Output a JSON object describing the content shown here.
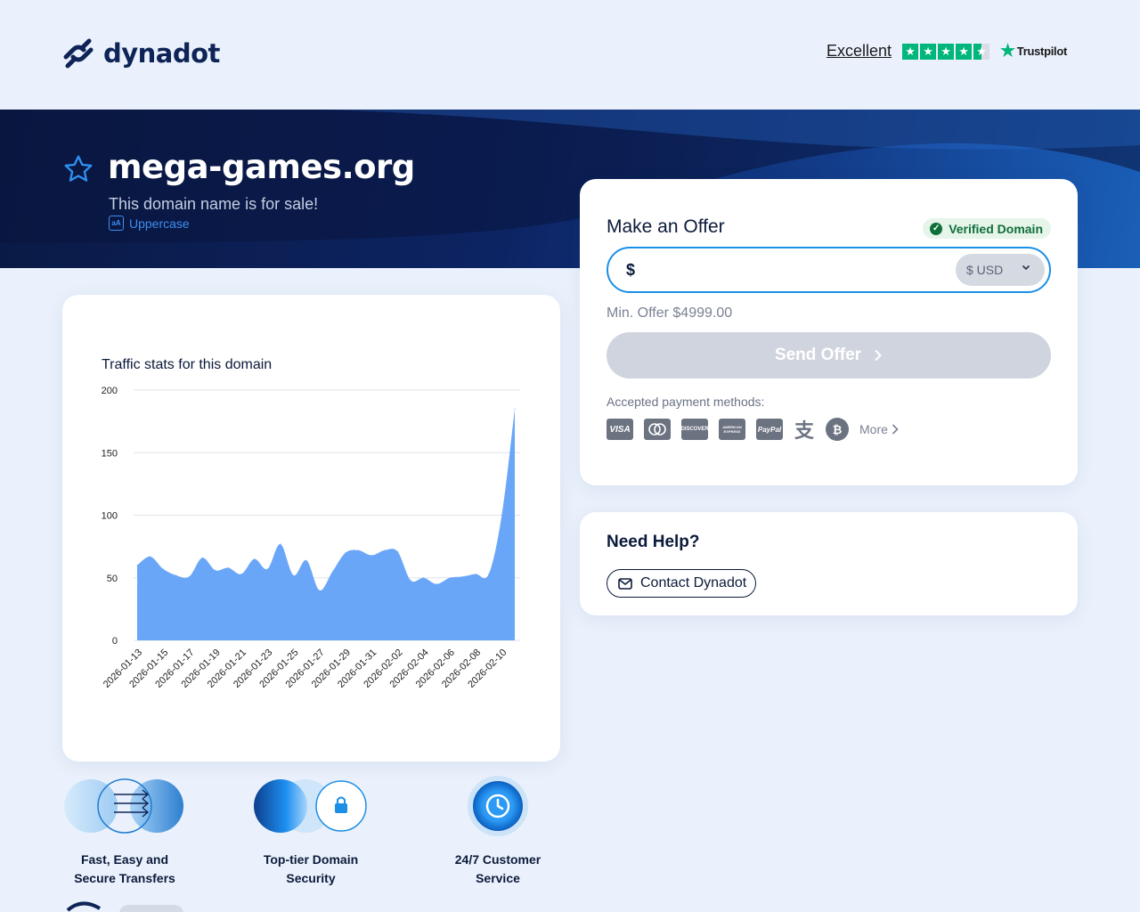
{
  "header": {
    "logo_text": "dynadot",
    "trustpilot": {
      "rating_word": "Excellent",
      "stars": 4.5,
      "brand": "Trustpilot",
      "star_color": "#00b67a"
    }
  },
  "hero": {
    "domain": "mega-games.org",
    "subtitle": "This domain name is for sale!",
    "uppercase_icon_text": "aA",
    "uppercase_label": "Uppercase"
  },
  "offer": {
    "title": "Make an Offer",
    "verified_label": "Verified Domain",
    "currency_symbol": "$",
    "amount_value": "",
    "currency_selected": "$ USD",
    "min_offer": "Min. Offer $4999.00",
    "send_label": "Send Offer",
    "accepted_label": "Accepted payment methods:",
    "payment_methods": [
      "VISA",
      "mastercard",
      "DISCOVER",
      "AMERICAN EXPRESS",
      "PayPal",
      "alipay-icon",
      "bitcoin-icon"
    ],
    "more_label": "More",
    "accent_color": "#1a8fe6"
  },
  "help": {
    "title": "Need Help?",
    "contact_label": "Contact Dynadot"
  },
  "chart_data": {
    "type": "area",
    "title": "Traffic stats for this domain",
    "ylim": [
      0,
      200
    ],
    "yticks": [
      0,
      50,
      100,
      150,
      200
    ],
    "x_tick_labels": [
      "2026-01-13",
      "2026-01-15",
      "2026-01-17",
      "2026-01-19",
      "2026-01-21",
      "2026-01-23",
      "2026-01-25",
      "2026-01-27",
      "2026-01-29",
      "2026-01-31",
      "2026-02-02",
      "2026-02-04",
      "2026-02-06",
      "2026-02-08",
      "2026-02-10"
    ],
    "x": [
      "2026-01-13",
      "2026-01-14",
      "2026-01-15",
      "2026-01-16",
      "2026-01-17",
      "2026-01-18",
      "2026-01-19",
      "2026-01-20",
      "2026-01-21",
      "2026-01-22",
      "2026-01-23",
      "2026-01-24",
      "2026-01-25",
      "2026-01-26",
      "2026-01-27",
      "2026-01-28",
      "2026-01-29",
      "2026-01-30",
      "2026-01-31",
      "2026-02-01",
      "2026-02-02",
      "2026-02-03",
      "2026-02-04",
      "2026-02-05",
      "2026-02-06",
      "2026-02-07",
      "2026-02-08",
      "2026-02-09",
      "2026-02-10",
      "2026-02-11"
    ],
    "values": [
      60,
      67,
      57,
      52,
      51,
      66,
      56,
      58,
      53,
      65,
      57,
      77,
      52,
      64,
      40,
      55,
      70,
      72,
      68,
      72,
      71,
      48,
      50,
      45,
      50,
      51,
      53,
      53,
      100,
      185
    ],
    "grid": true,
    "fill_color": "#6aa6f8"
  },
  "features": [
    {
      "label_line1": "Fast, Easy and",
      "label_line2": "Secure Transfers"
    },
    {
      "label_line1": "Top-tier Domain",
      "label_line2": "Security"
    },
    {
      "label_line1": "24/7 Customer",
      "label_line2": "Service"
    }
  ]
}
